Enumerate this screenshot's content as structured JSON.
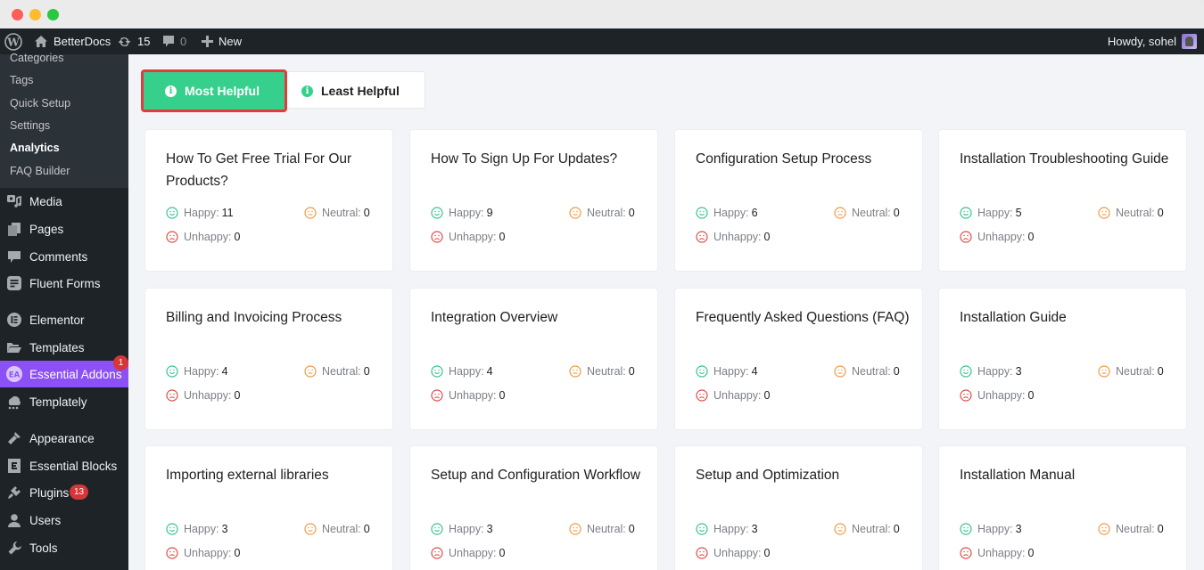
{
  "window": {
    "controls": [
      "close",
      "minimize",
      "maximize"
    ]
  },
  "adminbar": {
    "logo_icon": "wordpress-icon",
    "site_name": "BetterDocs",
    "updates_count": "15",
    "comments_count": "0",
    "new_label": "New",
    "greeting": "Howdy, sohel"
  },
  "sidebar": {
    "submenu": [
      {
        "label": "Categories",
        "current": false
      },
      {
        "label": "Tags",
        "current": false
      },
      {
        "label": "Quick Setup",
        "current": false
      },
      {
        "label": "Settings",
        "current": false
      },
      {
        "label": "Analytics",
        "current": true
      },
      {
        "label": "FAQ Builder",
        "current": false
      }
    ],
    "menu": [
      {
        "label": "Media",
        "icon": "media-icon"
      },
      {
        "label": "Pages",
        "icon": "pages-icon"
      },
      {
        "label": "Comments",
        "icon": "comments-icon"
      },
      {
        "label": "Fluent Forms",
        "icon": "fluent-forms-icon"
      },
      {
        "label": "Elementor",
        "icon": "elementor-icon"
      },
      {
        "label": "Templates",
        "icon": "folder-icon"
      },
      {
        "label": "Essential Addons",
        "icon": "essential-addons-icon",
        "badge": "1",
        "active": true
      },
      {
        "label": "Templately",
        "icon": "templately-icon"
      },
      {
        "label": "Appearance",
        "icon": "paintbrush-icon"
      },
      {
        "label": "Essential Blocks",
        "icon": "essential-blocks-icon"
      },
      {
        "label": "Plugins",
        "icon": "plugin-icon",
        "badge": "13"
      },
      {
        "label": "Users",
        "icon": "user-icon"
      },
      {
        "label": "Tools",
        "icon": "wrench-icon"
      }
    ]
  },
  "tabs": {
    "most_helpful": "Most Helpful",
    "least_helpful": "Least Helpful",
    "active": "most_helpful"
  },
  "labels": {
    "happy": "Happy:",
    "neutral": "Neutral:",
    "unhappy": "Unhappy:"
  },
  "colors": {
    "accent_green": "#36d08c",
    "highlight_red": "#e23b3b",
    "happy": "#36c38f",
    "neutral": "#ee9a45",
    "unhappy": "#e04a4a",
    "sidebar_active": "#8c51f5"
  },
  "docs": [
    {
      "title": "How To Get Free Trial For Our Products?",
      "happy": "11",
      "neutral": "0",
      "unhappy": "0"
    },
    {
      "title": "How To Sign Up For Updates?",
      "happy": "9",
      "neutral": "0",
      "unhappy": "0"
    },
    {
      "title": "Configuration Setup Process",
      "happy": "6",
      "neutral": "0",
      "unhappy": "0"
    },
    {
      "title": "Installation Troubleshooting Guide",
      "happy": "5",
      "neutral": "0",
      "unhappy": "0"
    },
    {
      "title": "Billing and Invoicing Process",
      "happy": "4",
      "neutral": "0",
      "unhappy": "0"
    },
    {
      "title": "Integration Overview",
      "happy": "4",
      "neutral": "0",
      "unhappy": "0"
    },
    {
      "title": "Frequently Asked Questions (FAQ)",
      "happy": "4",
      "neutral": "0",
      "unhappy": "0"
    },
    {
      "title": "Installation Guide",
      "happy": "3",
      "neutral": "0",
      "unhappy": "0"
    },
    {
      "title": "Importing external libraries",
      "happy": "3",
      "neutral": "0",
      "unhappy": "0"
    },
    {
      "title": "Setup and Configuration Workflow",
      "happy": "3",
      "neutral": "0",
      "unhappy": "0"
    },
    {
      "title": "Setup and Optimization",
      "happy": "3",
      "neutral": "0",
      "unhappy": "0"
    },
    {
      "title": "Installation Manual",
      "happy": "3",
      "neutral": "0",
      "unhappy": "0"
    }
  ]
}
